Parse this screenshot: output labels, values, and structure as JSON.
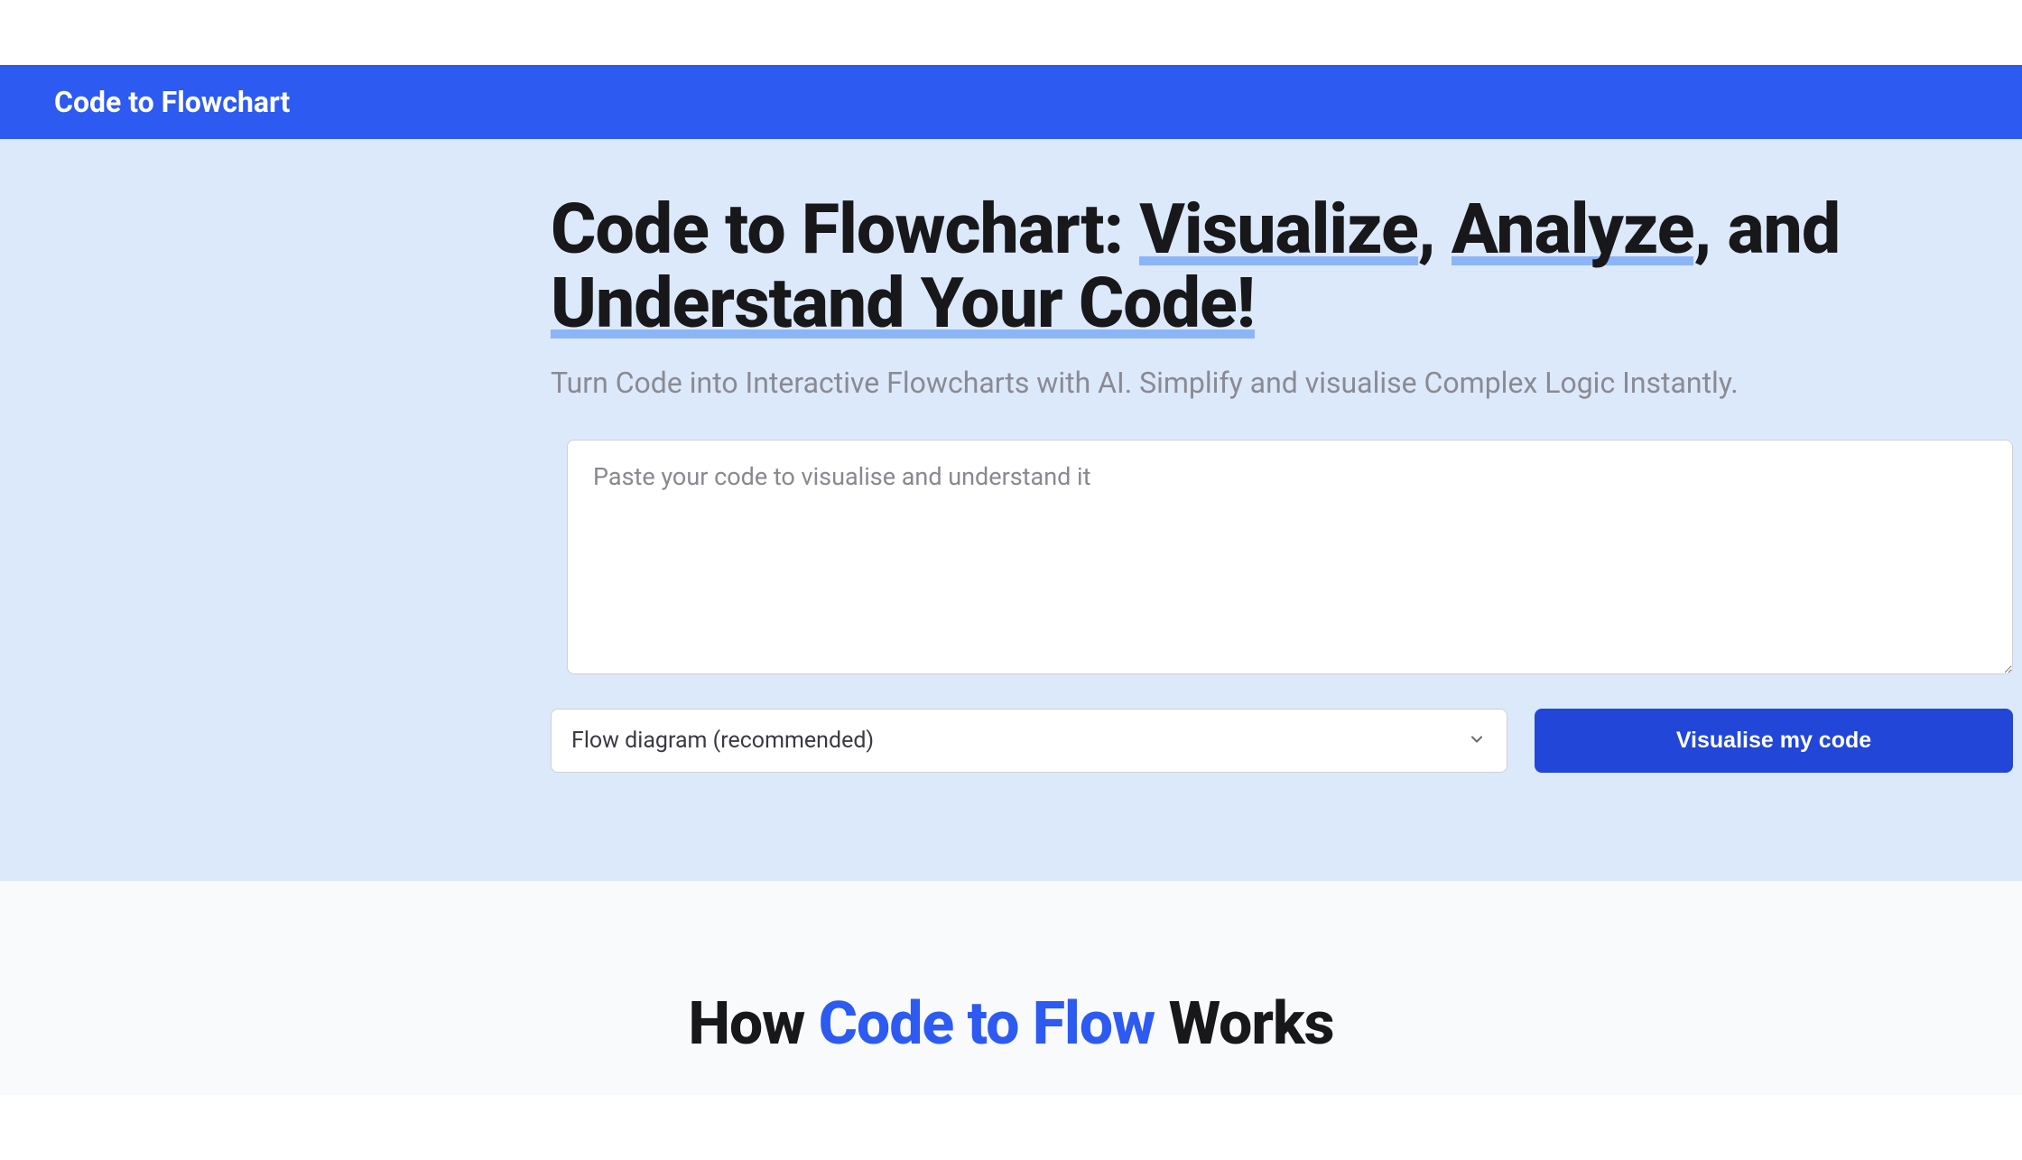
{
  "nav": {
    "brand": "Code to Flowchart"
  },
  "hero": {
    "title_part1": "Code to Flowchart: ",
    "title_underline1": "Visualize",
    "title_part2": ", ",
    "title_underline2": "Analyze",
    "title_part3": ", and ",
    "title_underline3": "Understand Your Code!",
    "subtitle": "Turn Code into Interactive Flowcharts with AI. Simplify and visualise Complex Logic Instantly."
  },
  "form": {
    "code_placeholder": "Paste your code to visualise and understand it",
    "code_value": "",
    "diagram_type_selected": "Flow diagram (recommended)",
    "visualise_label": "Visualise my code"
  },
  "how_section": {
    "part1": "How ",
    "accent": "Code to Flow",
    "part2": " Works"
  }
}
